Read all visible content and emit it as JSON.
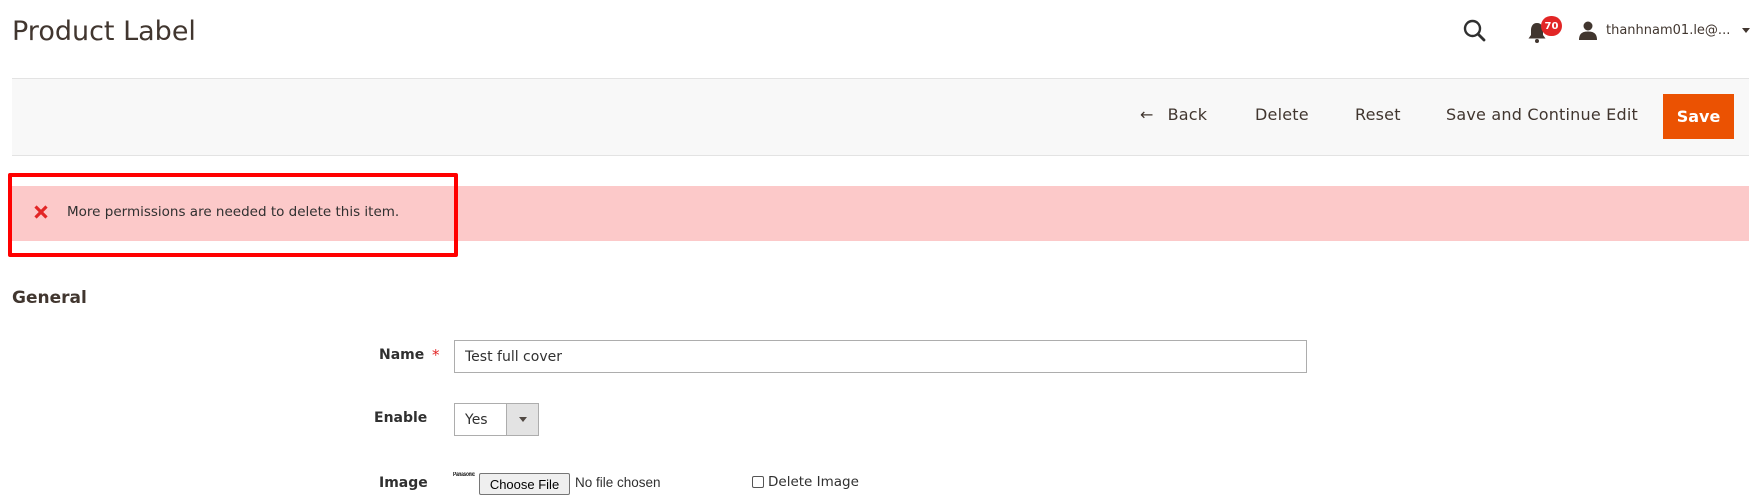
{
  "header": {
    "title": "Product Label",
    "notifications_count": "70",
    "user_name": "thanhnam01.le@...",
    "icons": {
      "search": "search-icon",
      "notifications": "bell-icon",
      "user": "user-icon",
      "user_menu": "caret-down-icon"
    }
  },
  "toolbar": {
    "back_arrow": "←",
    "back_label": "Back",
    "delete_label": "Delete",
    "reset_label": "Reset",
    "save_continue_label": "Save and Continue Edit",
    "save_label": "Save",
    "accent_color": "#eb5202"
  },
  "message": {
    "type": "error",
    "icon": "error-x-icon",
    "text": "More permissions are needed to delete this item.",
    "background_color": "#fcc9c9",
    "highlight_color": "#ff0000"
  },
  "form": {
    "section_title": "General",
    "fields": {
      "name": {
        "label": "Name",
        "required_mark": "*",
        "value": "Test full cover"
      },
      "enable": {
        "label": "Enable",
        "selected": "Yes"
      },
      "image": {
        "label": "Image",
        "preview_text": "Panasonic",
        "choose_file_label": "Choose File",
        "no_file_text": "No file chosen",
        "delete_checkbox_label": "Delete Image",
        "delete_checked": false
      }
    }
  }
}
